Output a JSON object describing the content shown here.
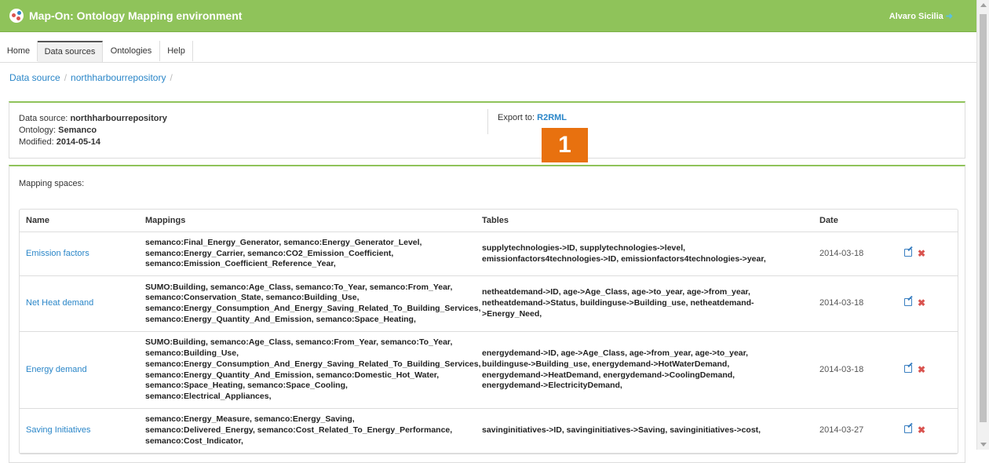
{
  "header": {
    "title": "Map-On: Ontology Mapping environment",
    "user": "Alvaro Sicilia",
    "logout_icon": "sign-out-icon"
  },
  "nav": {
    "tabs": [
      {
        "label": "Home",
        "active": false
      },
      {
        "label": "Data sources",
        "active": true
      },
      {
        "label": "Ontologies",
        "active": false
      },
      {
        "label": "Help",
        "active": false
      }
    ]
  },
  "breadcrumb": [
    "Data source",
    "northharbourrepository"
  ],
  "datasource": {
    "label_ds": "Data source:",
    "value_ds": "northharbourrepository",
    "label_onto": "Ontology:",
    "value_onto": "Semanco",
    "label_mod": "Modified:",
    "value_mod": "2014-05-14",
    "export_label": "Export to:",
    "export_link": "R2RML"
  },
  "badge": "1",
  "mapping_spaces": {
    "label": "Mapping spaces:",
    "headers": [
      "Name",
      "Mappings",
      "Tables",
      "Date"
    ],
    "rows": [
      {
        "name": "Emission factors",
        "mappings": [
          "semanco:Final_Energy_Generator, semanco:Energy_Generator_Level,",
          "semanco:Energy_Carrier, semanco:CO2_Emission_Coefficient,",
          "semanco:Emission_Coefficient_Reference_Year,"
        ],
        "tables": [
          "supplytechnologies->ID, supplytechnologies->level,",
          "emissionfactors4technologies->ID, emissionfactors4technologies->year,"
        ],
        "date": "2014-03-18"
      },
      {
        "name": "Net Heat demand",
        "mappings": [
          "SUMO:Building, semanco:Age_Class, semanco:To_Year, semanco:From_Year,",
          "semanco:Conservation_State, semanco:Building_Use,",
          "semanco:Energy_Consumption_And_Energy_Saving_Related_To_Building_Services,",
          "semanco:Energy_Quantity_And_Emission, semanco:Space_Heating,"
        ],
        "tables": [
          "netheatdemand->ID, age->Age_Class, age->to_year, age->from_year,",
          "netheatdemand->Status, buildinguse->Building_use, netheatdemand-",
          ">Energy_Need,"
        ],
        "date": "2014-03-18"
      },
      {
        "name": "Energy demand",
        "mappings": [
          "SUMO:Building, semanco:Age_Class, semanco:From_Year, semanco:To_Year,",
          "semanco:Building_Use,",
          "semanco:Energy_Consumption_And_Energy_Saving_Related_To_Building_Services,",
          "semanco:Energy_Quantity_And_Emission, semanco:Domestic_Hot_Water,",
          "semanco:Space_Heating, semanco:Space_Cooling,",
          "semanco:Electrical_Appliances,"
        ],
        "tables": [
          "energydemand->ID, age->Age_Class, age->from_year, age->to_year,",
          "buildinguse->Building_use, energydemand->HotWaterDemand,",
          "energydemand->HeatDemand, energydemand->CoolingDemand,",
          "energydemand->ElectricityDemand,"
        ],
        "date": "2014-03-18"
      },
      {
        "name": "Saving Initiatives",
        "mappings": [
          "semanco:Energy_Measure, semanco:Energy_Saving,",
          "semanco:Delivered_Energy, semanco:Cost_Related_To_Energy_Performance,",
          "semanco:Cost_Indicator,"
        ],
        "tables": [
          "savinginitiatives->ID, savinginitiatives->Saving, savinginitiatives->cost,"
        ],
        "date": "2014-03-27"
      }
    ]
  },
  "colors": {
    "header_bg": "#8fc35a",
    "link": "#2a86c8",
    "badge": "#e8710f",
    "delete": "#d9534f"
  }
}
